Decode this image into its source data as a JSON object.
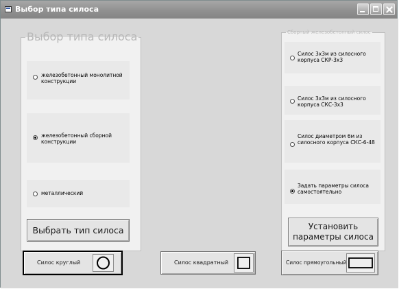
{
  "window": {
    "title": "Выбор типа силоса"
  },
  "left_group": {
    "legend": "Выбор типа силоса",
    "options": [
      {
        "label": "железобетонный монолитной конструкции",
        "checked": false
      },
      {
        "label": "железобетонный сборной конструкции",
        "checked": true
      },
      {
        "label": "металлический",
        "checked": false
      }
    ],
    "button_label": "Выбрать тип силоса"
  },
  "right_group": {
    "legend": "Сборный железобетонный силос",
    "options": [
      {
        "label": "Силос 3х3м из силосного корпуса СКР-3х3",
        "checked": false
      },
      {
        "label": "Силос 3х3м из силосного корпуса СКС-3х3",
        "checked": false
      },
      {
        "label": "Силос диаметром 6м из силосного корпуса СКС-6-48",
        "checked": false
      },
      {
        "label": "Задать параметры силоса самостоятельно",
        "checked": true
      }
    ],
    "button_label": "Установить параметры силоса"
  },
  "bottom_buttons": {
    "round": "Силос круглый",
    "square": "Силос квадратный",
    "rect": "Силос прямоугольный"
  },
  "icons": {
    "round": "circle-icon",
    "square": "square-icon",
    "rect": "rectangle-icon"
  }
}
